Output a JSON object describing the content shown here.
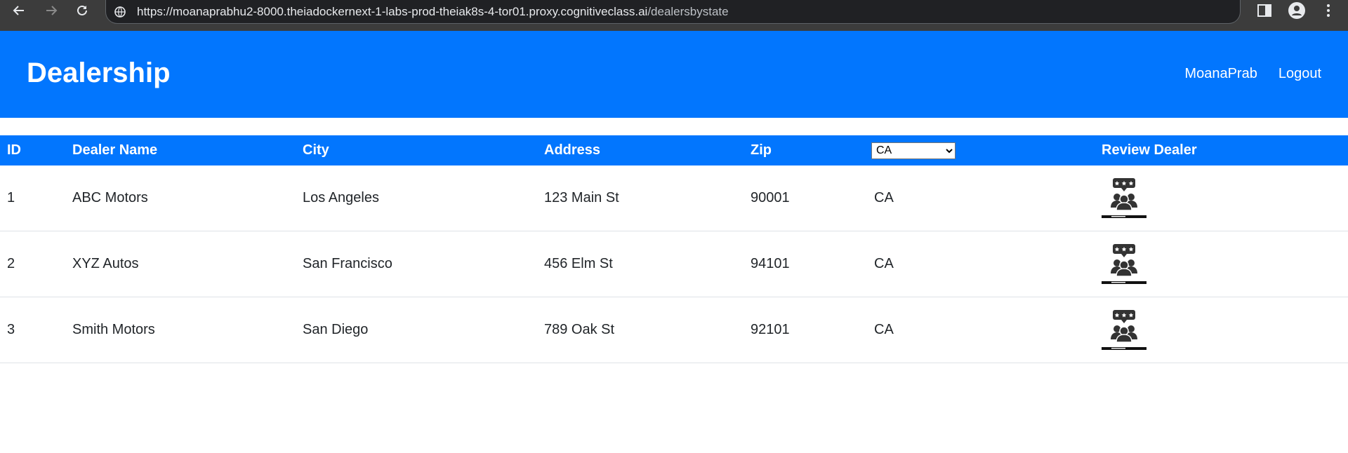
{
  "browser": {
    "url_host": "https://moanaprabhu2-8000.theiadockernext-1-labs-prod-theiak8s-4-tor01.proxy.cognitiveclass.ai",
    "url_path": "/dealersbystate",
    "icons": [
      "back-arrow-icon",
      "forward-arrow-icon",
      "reload-icon",
      "site-info-icon",
      "side-panel-icon",
      "profile-icon",
      "kebab-menu-icon"
    ]
  },
  "header": {
    "title": "Dealership",
    "user_link": "MoanaPrab",
    "logout_link": "Logout",
    "background": "#0276fe"
  },
  "table": {
    "columns": {
      "id": "ID",
      "dealer_name": "Dealer Name",
      "city": "City",
      "address": "Address",
      "zip": "Zip",
      "review": "Review Dealer"
    },
    "state_filter": {
      "selected": "CA"
    },
    "rows": [
      {
        "id": "1",
        "dealer_name": "ABC Motors",
        "city": "Los Angeles",
        "address": "123 Main St",
        "zip": "90001",
        "state": "CA",
        "review_icon": "review-dealer-icon"
      },
      {
        "id": "2",
        "dealer_name": "XYZ Autos",
        "city": "San Francisco",
        "address": "456 Elm St",
        "zip": "94101",
        "state": "CA",
        "review_icon": "review-dealer-icon"
      },
      {
        "id": "3",
        "dealer_name": "Smith Motors",
        "city": "San Diego",
        "address": "789 Oak St",
        "zip": "92101",
        "state": "CA",
        "review_icon": "review-dealer-icon"
      }
    ]
  }
}
